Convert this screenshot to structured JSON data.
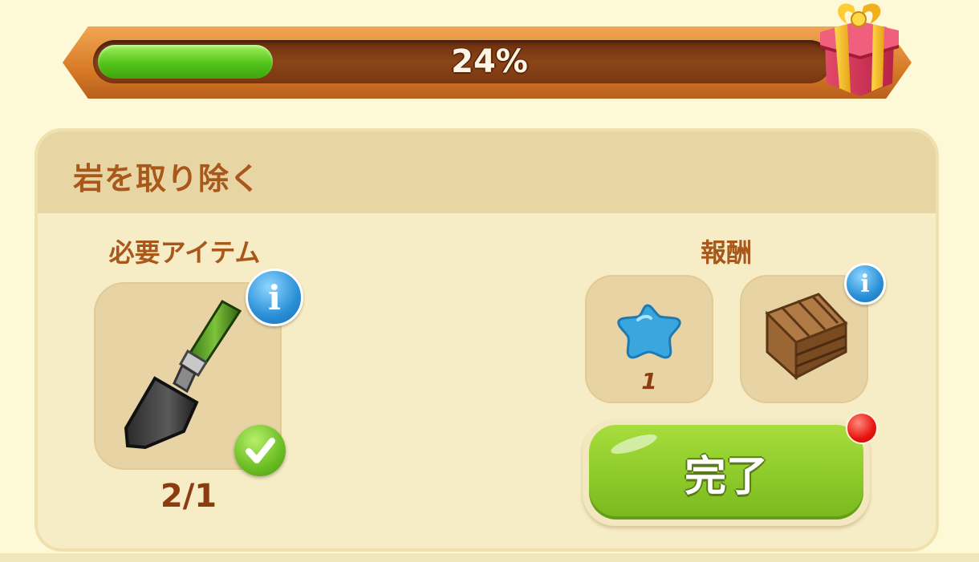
{
  "progress": {
    "percent_text": "24%",
    "value": 0.24
  },
  "reward_chest": {
    "icon": "gift-box-icon"
  },
  "task": {
    "title": "岩を取り除く",
    "required": {
      "label": "必要アイテム",
      "item_icon": "trowel-icon",
      "count": "2/1",
      "status_icon": "check-icon",
      "info_icon": "info-icon"
    },
    "rewards": {
      "label": "報酬",
      "items": [
        {
          "icon": "blue-star-icon",
          "count": "1"
        },
        {
          "icon": "wooden-crate-icon",
          "info_icon": "info-icon"
        }
      ]
    },
    "complete_button": {
      "label": "完了",
      "notification": true
    }
  },
  "colors": {
    "background": "#fdf9d6",
    "title_text": "#a9581c",
    "progress_fill": "#53c41a",
    "button_green": "#8fcc2b",
    "info_blue": "#2a8fd6",
    "notification_red": "#e8130f"
  }
}
